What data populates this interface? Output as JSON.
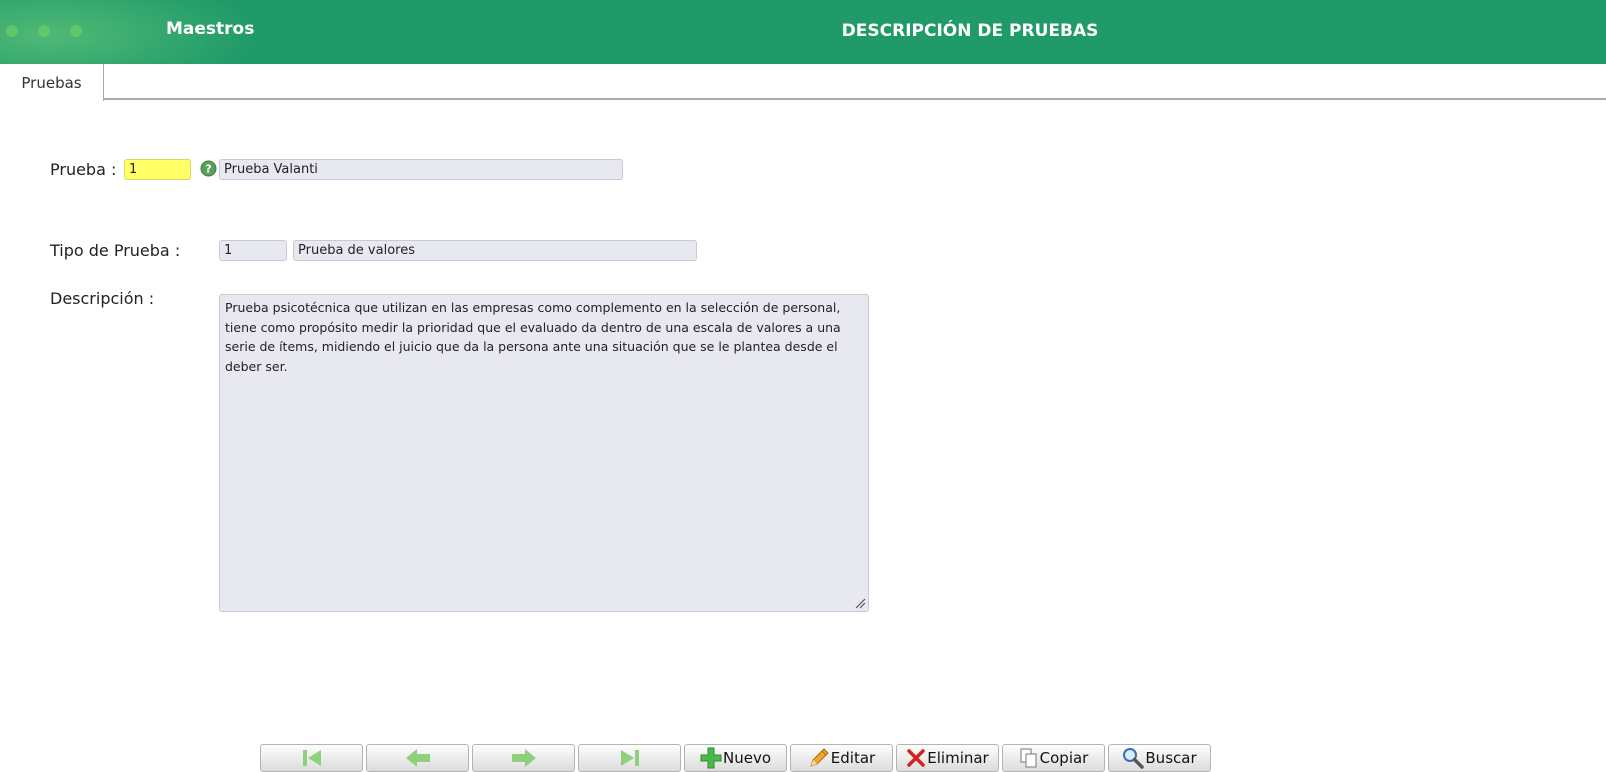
{
  "header": {
    "app_name": "Maestros",
    "title": "DESCRIPCIÓN DE PRUEBAS",
    "brand_color": "#1f9a68"
  },
  "tabs": [
    {
      "label": "Pruebas",
      "active": true
    }
  ],
  "form": {
    "prueba": {
      "label": "Prueba :",
      "code": "1",
      "name": "Prueba Valanti"
    },
    "tipo_prueba": {
      "label": "Tipo de Prueba :",
      "code": "1",
      "name": "Prueba de valores"
    },
    "descripcion": {
      "label": "Descripción :",
      "text": "Prueba psicotécnica que utilizan en las empresas como complemento en la selección de personal, tiene como propósito medir la prioridad que el evaluado da dentro de una escala de valores a una serie de ítems, midiendo el juicio que da la persona ante una situación que se le plantea desde el deber ser."
    }
  },
  "toolbar": {
    "first_icon": "first-record-icon",
    "prev_icon": "previous-record-icon",
    "next_icon": "next-record-icon",
    "last_icon": "last-record-icon",
    "new_label": "Nuevo",
    "edit_label": "Editar",
    "delete_label": "Eliminar",
    "copy_label": "Copiar",
    "search_label": "Buscar"
  }
}
